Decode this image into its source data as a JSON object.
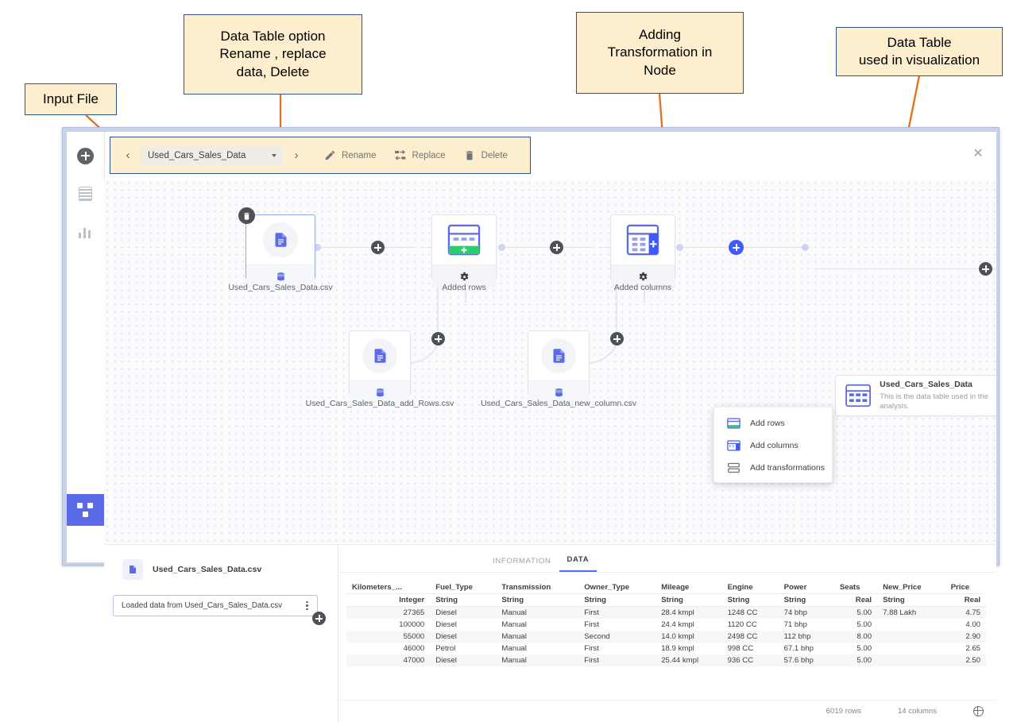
{
  "annotations": [
    {
      "id": "input-file",
      "text": "Input File"
    },
    {
      "id": "data-table-option",
      "text": "Data Table option Rename , replace data,  Delete"
    },
    {
      "id": "adding-transformation",
      "text": "Adding Transformation in Node"
    },
    {
      "id": "data-table-used",
      "text": "Data Table used in visualization"
    }
  ],
  "annotation_lines": {
    "input_file": "Input File",
    "data_table_option_l1": "Data Table option",
    "data_table_option_l2": "Rename , replace",
    "data_table_option_l3": "data,  Delete",
    "adding_transformation_l1": "Adding",
    "adding_transformation_l2": "Transformation in",
    "adding_transformation_l3": "Node",
    "data_table_used_l1": "Data Table",
    "data_table_used_l2": "used in visualization"
  },
  "app": {
    "toolbar": {
      "prev_label": "‹",
      "next_label": "›",
      "selected_table": "Used_Cars_Sales_Data",
      "rename_label": "Rename",
      "replace_label": "Replace",
      "delete_label": "Delete"
    },
    "close_label": "✕",
    "sidebar": {
      "items": [
        {
          "name": "add",
          "label": "add-icon"
        },
        {
          "name": "pages",
          "label": "pages-icon"
        },
        {
          "name": "visualizations",
          "label": "chart-icon"
        },
        {
          "name": "data-canvas",
          "label": "flow-icon"
        }
      ]
    },
    "canvas": {
      "nodes": [
        {
          "id": "source-csv",
          "label": "Used_Cars_Sales_Data.csv"
        },
        {
          "id": "added-rows",
          "label": "Added rows"
        },
        {
          "id": "added-columns",
          "label": "Added columns"
        },
        {
          "id": "add-rows-csv",
          "label": "Used_Cars_Sales_Data_add_Rows.csv"
        },
        {
          "id": "new-column-csv",
          "label": "Used_Cars_Sales_Data_new_column.csv"
        }
      ],
      "data_table": {
        "title": "Used_Cars_Sales_Data",
        "description": "This is the data table used in the analysis."
      },
      "menu": {
        "items": [
          {
            "id": "add-rows",
            "label": "Add rows"
          },
          {
            "id": "add-columns",
            "label": "Add columns"
          },
          {
            "id": "add-transformations",
            "label": "Add transformations"
          }
        ]
      }
    },
    "bottom": {
      "source_file": "Used_Cars_Sales_Data.csv",
      "operation": "Loaded data from Used_Cars_Sales_Data.csv",
      "tabs": [
        {
          "id": "information",
          "label": "INFORMATION",
          "active": false
        },
        {
          "id": "data",
          "label": "DATA",
          "active": true
        }
      ],
      "table": {
        "columns": [
          "Kilometers_...",
          "Fuel_Type",
          "Transmission",
          "Owner_Type",
          "Mileage",
          "Engine",
          "Power",
          "Seats",
          "New_Price",
          "Price"
        ],
        "types": [
          "Integer",
          "String",
          "String",
          "String",
          "String",
          "String",
          "String",
          "Real",
          "String",
          "Real"
        ],
        "align": [
          "right",
          "left",
          "left",
          "left",
          "left",
          "left",
          "left",
          "right",
          "left",
          "right"
        ],
        "rows": [
          [
            "27365",
            "Diesel",
            "Manual",
            "First",
            "28.4 kmpl",
            "1248 CC",
            "74 bhp",
            "5.00",
            "7.88 Lakh",
            "4.75"
          ],
          [
            "100000",
            "Diesel",
            "Manual",
            "First",
            "24.4 kmpl",
            "1120 CC",
            "71 bhp",
            "5.00",
            "",
            "4.00"
          ],
          [
            "55000",
            "Diesel",
            "Manual",
            "Second",
            "14.0 kmpl",
            "2498 CC",
            "112 bhp",
            "8.00",
            "",
            "2.90"
          ],
          [
            "46000",
            "Petrol",
            "Manual",
            "First",
            "18.9 kmpl",
            "998 CC",
            "67.1 bhp",
            "5.00",
            "",
            "2.65"
          ],
          [
            "47000",
            "Diesel",
            "Manual",
            "First",
            "25.44 kmpl",
            "936 CC",
            "57.6 bhp",
            "5.00",
            "",
            "2.50"
          ]
        ]
      },
      "footer": {
        "rows": "6019 rows",
        "columns": "14 columns"
      }
    }
  },
  "colors": {
    "callout_fill": "#fdeecd",
    "callout_border": "#2e5388",
    "arrow": "#e2711d",
    "accent_blue": "#4f6df5",
    "node_blue": "#5b6ae8",
    "green": "#2ecc71"
  }
}
